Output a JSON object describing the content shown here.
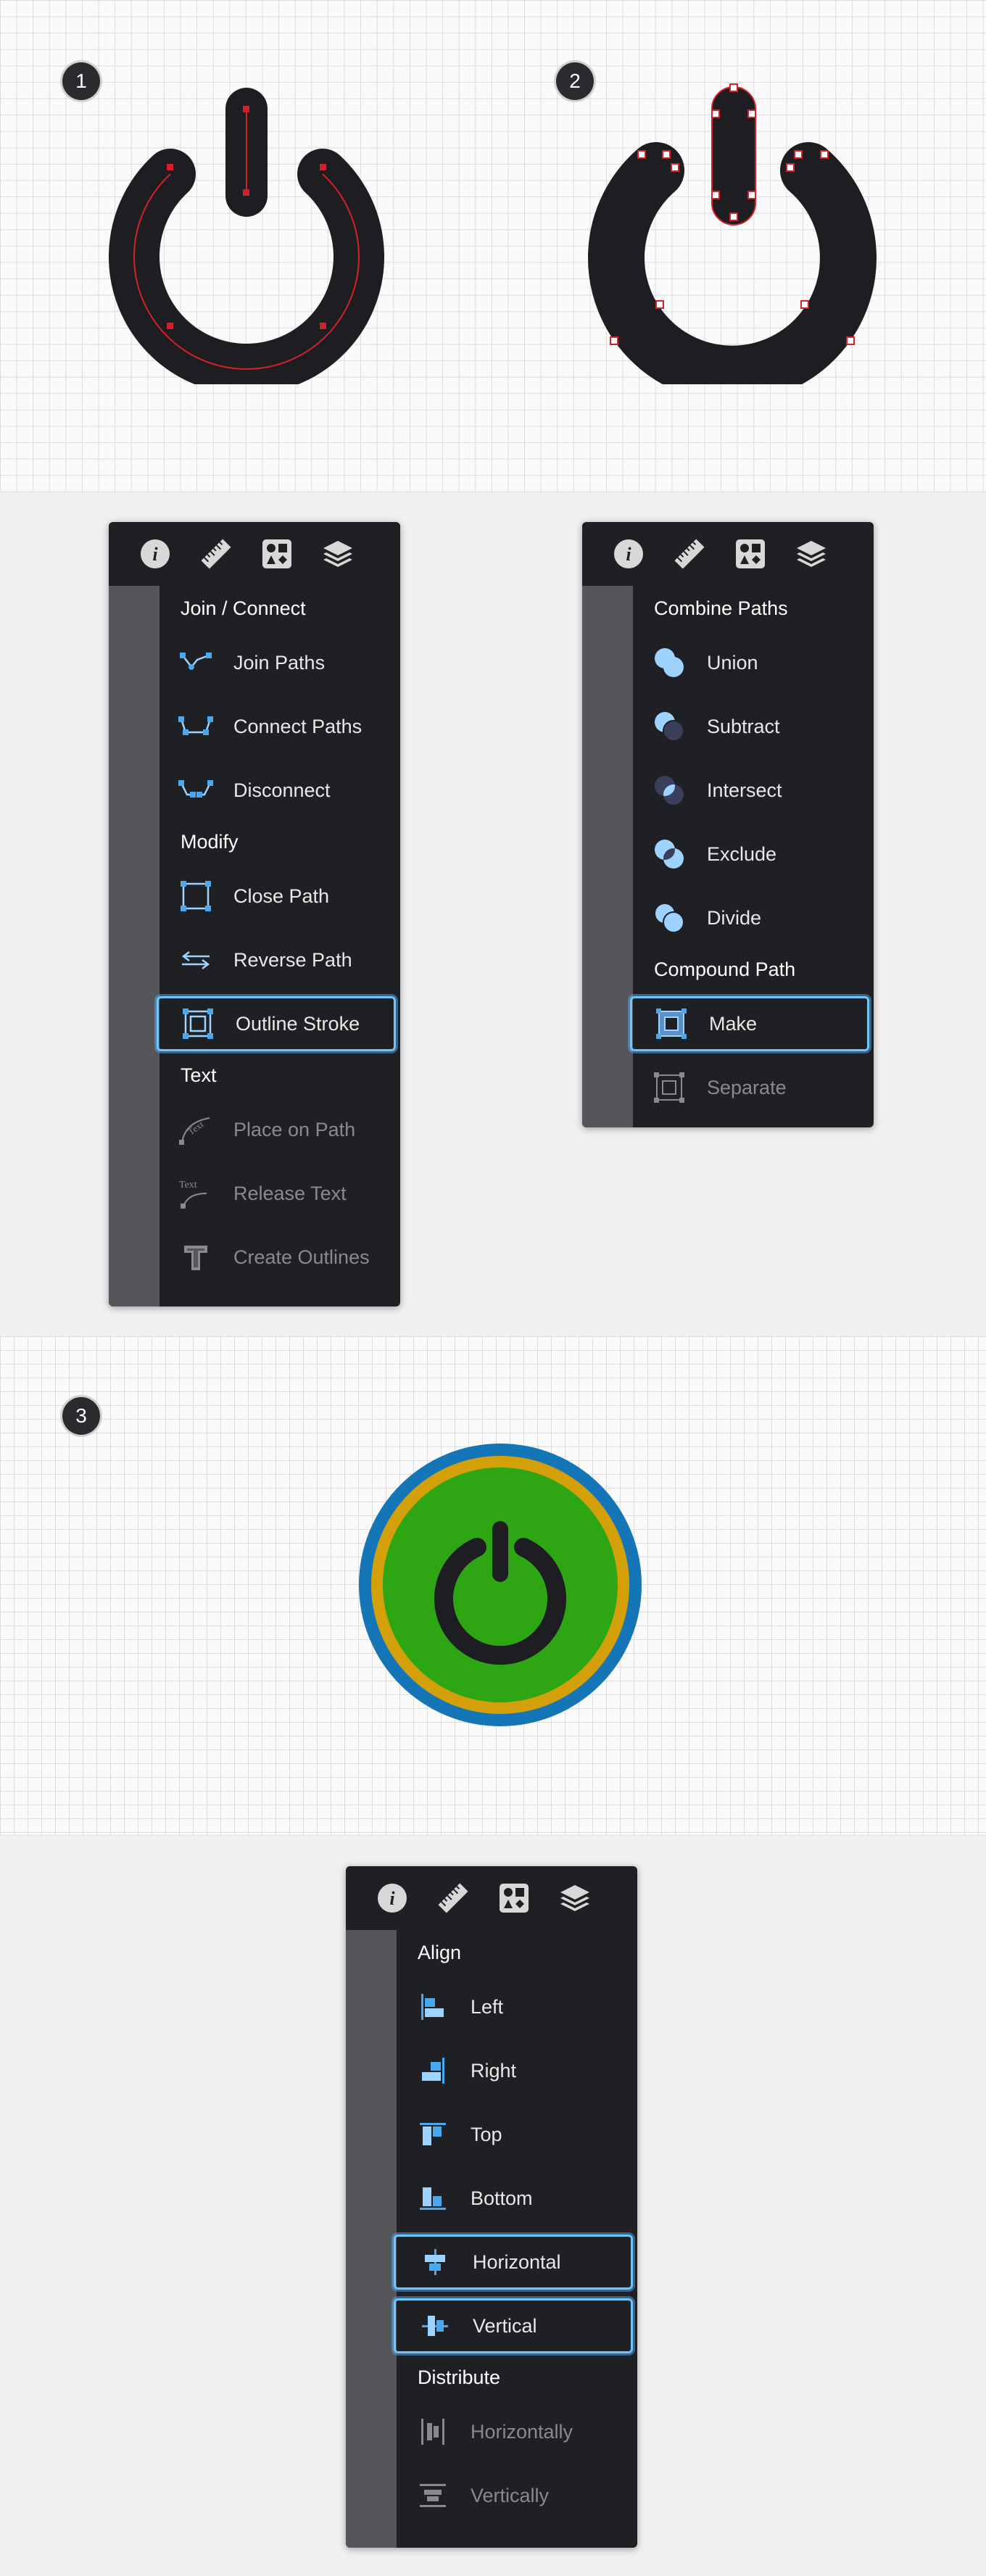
{
  "steps": [
    "1",
    "2",
    "3"
  ],
  "palette_tabs": [
    "info-icon",
    "ruler-icon",
    "shapes-icon",
    "layers-icon"
  ],
  "panel1": {
    "sections": [
      {
        "title": "Join / Connect",
        "items": [
          {
            "label": "Join Paths",
            "icon": "join-paths-icon",
            "state": "normal"
          },
          {
            "label": "Connect Paths",
            "icon": "connect-paths-icon",
            "state": "normal"
          },
          {
            "label": "Disconnect",
            "icon": "disconnect-icon",
            "state": "normal"
          }
        ]
      },
      {
        "title": "Modify",
        "items": [
          {
            "label": "Close Path",
            "icon": "close-path-icon",
            "state": "normal"
          },
          {
            "label": "Reverse Path",
            "icon": "reverse-path-icon",
            "state": "normal"
          },
          {
            "label": "Outline Stroke",
            "icon": "outline-stroke-icon",
            "state": "selected"
          }
        ]
      },
      {
        "title": "Text",
        "items": [
          {
            "label": "Place on Path",
            "icon": "place-on-path-icon",
            "state": "disabled"
          },
          {
            "label": "Release Text",
            "icon": "release-text-icon",
            "state": "disabled"
          },
          {
            "label": "Create Outlines",
            "icon": "create-outlines-icon",
            "state": "disabled"
          }
        ]
      }
    ]
  },
  "panel2": {
    "sections": [
      {
        "title": "Combine Paths",
        "items": [
          {
            "label": "Union",
            "icon": "union-icon",
            "state": "normal"
          },
          {
            "label": "Subtract",
            "icon": "subtract-icon",
            "state": "normal"
          },
          {
            "label": "Intersect",
            "icon": "intersect-icon",
            "state": "normal"
          },
          {
            "label": "Exclude",
            "icon": "exclude-icon",
            "state": "normal"
          },
          {
            "label": "Divide",
            "icon": "divide-icon",
            "state": "normal"
          }
        ]
      },
      {
        "title": "Compound Path",
        "items": [
          {
            "label": "Make",
            "icon": "compound-make-icon",
            "state": "selected"
          },
          {
            "label": "Separate",
            "icon": "compound-separate-icon",
            "state": "disabled"
          }
        ]
      }
    ]
  },
  "panel3": {
    "sections": [
      {
        "title": "Align",
        "items": [
          {
            "label": "Left",
            "icon": "align-left-icon",
            "state": "normal"
          },
          {
            "label": "Right",
            "icon": "align-right-icon",
            "state": "normal"
          },
          {
            "label": "Top",
            "icon": "align-top-icon",
            "state": "normal"
          },
          {
            "label": "Bottom",
            "icon": "align-bottom-icon",
            "state": "normal"
          },
          {
            "label": "Horizontal",
            "icon": "align-horizontal-icon",
            "state": "selected"
          },
          {
            "label": "Vertical",
            "icon": "align-vertical-icon",
            "state": "selected"
          }
        ]
      },
      {
        "title": "Distribute",
        "items": [
          {
            "label": "Horizontally",
            "icon": "distribute-horizontally-icon",
            "state": "disabled"
          },
          {
            "label": "Vertically",
            "icon": "distribute-vertically-icon",
            "state": "disabled"
          }
        ]
      }
    ]
  },
  "colors": {
    "icon_dark": "#1e1e22",
    "anchor_red": "#d4202a",
    "button_green": "#2ea614",
    "ring_gold": "#d4a00a",
    "ring_blue": "#1476b6",
    "accent_blue": "#4aa8f0",
    "selection_border": "#6ec6ff"
  }
}
